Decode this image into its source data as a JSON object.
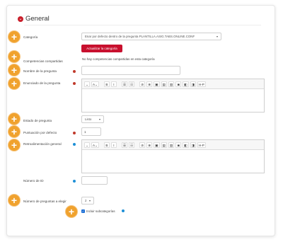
{
  "section": {
    "title": "General",
    "collapse_icon": "chevron-down-icon"
  },
  "add_marker_symbol": "+",
  "fields": {
    "category": {
      "label": "Categoría",
      "selected": "Enar por defecto dentro de la pregunta PLANTILLA.ASIG.TABS.ONLINE.CONF",
      "update_button": "Actualizar la categoría"
    },
    "competencies": {
      "label": "Competencias compartidas",
      "value": "No hay competencias compartidas en esta categoría"
    },
    "question_name": {
      "label": "Nombre de la pregunta",
      "value": ""
    },
    "question_text": {
      "label": "Enunciado de la pregunta"
    },
    "question_status": {
      "label": "Estado de pregunta",
      "selected": "Listo"
    },
    "default_mark": {
      "label": "Puntuación por defecto",
      "value": "1"
    },
    "general_feedback": {
      "label": "Retroalimentación general"
    },
    "id_number": {
      "label": "Número de ID",
      "value": ""
    },
    "choices": {
      "label": "Número de preguntas a elegir",
      "selected": "2"
    },
    "include_subcategories": {
      "label": "Incluir subcategorías"
    }
  },
  "toolbar": [
    "⌄",
    "A⌄",
    "B",
    "I",
    "☰",
    "☷",
    "⊘",
    "⊗",
    "▣",
    "▤",
    "▥",
    "◙",
    "◧",
    "◨",
    "H-P"
  ],
  "colors": {
    "accent_red": "#c8102e",
    "marker_orange": "#f0a22e",
    "help_blue": "#1d8fd6"
  }
}
